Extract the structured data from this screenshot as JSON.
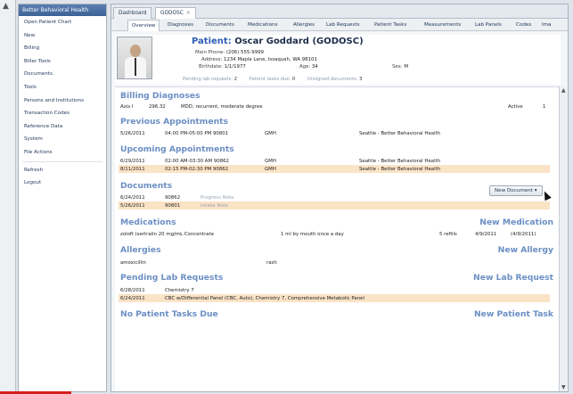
{
  "sidebar": {
    "header": "Better Behavioral Health",
    "items": [
      "Open Patient Chart",
      "New",
      "Billing",
      "Biller Tools",
      "Documents",
      "Tools",
      "Persons and Institutions",
      "Transaction Codes",
      "Reference Data",
      "System",
      "File Actions"
    ],
    "items2": [
      "Refresh",
      "Logout"
    ]
  },
  "top_tabs": [
    "Dashboard",
    "GODOSC"
  ],
  "sub_tabs": [
    "Overview",
    "Diagnoses",
    "Documents",
    "Medications",
    "Allergies",
    "Lab Requests",
    "Patient Tasks",
    "Measurements",
    "Lab Panels",
    "Codes",
    "Ima"
  ],
  "patient": {
    "label": "Patient:",
    "name": "Oscar Goddard (GODOSC)",
    "main_phone_k": "Main Phone:",
    "main_phone": "(206) 555-9999",
    "address_k": "Address:",
    "address": "1234 Maple Lane, Issaquah, WA 98101",
    "birthdate_k": "Birthdate:",
    "birthdate": "1/1/1977",
    "age_k": "Age:",
    "age": "34",
    "sex_k": "Sex:",
    "sex": "M",
    "pending_lab_k": "Pending lab requests:",
    "pending_lab": "2",
    "tasks_due_k": "Patient tasks due:",
    "tasks_due": "0",
    "unsigned_k": "Unsigned documents:",
    "unsigned": "3"
  },
  "billing": {
    "title": "Billing Diagnoses",
    "rows": [
      {
        "axis": "Axis I",
        "code": "296.32",
        "desc": "MDD, recurrent, moderate degree",
        "status": "Active",
        "n": "1"
      }
    ]
  },
  "previous": {
    "title": "Previous Appointments",
    "rows": [
      {
        "date": "5/26/2011",
        "time": "04:00 PM-05:00 PM 90801",
        "prov": "GMH",
        "loc": "Seattle - Better Behavioral Health"
      }
    ]
  },
  "upcoming": {
    "title": "Upcoming Appointments",
    "rows": [
      {
        "date": "6/29/2011",
        "time": "02:00 AM-03:30 AM 90862",
        "prov": "GMH",
        "loc": "Seattle - Better Behavioral Health"
      },
      {
        "date": "8/11/2011",
        "time": "02:15 PM-02:30 PM 90862",
        "prov": "GMH",
        "loc": "Seattle - Better Behavioral Health"
      }
    ]
  },
  "documents": {
    "title": "Documents",
    "new_button": "New Document",
    "rows": [
      {
        "date": "6/24/2011",
        "code": "90862",
        "note": "Progress Note"
      },
      {
        "date": "5/26/2011",
        "code": "90801",
        "note": "Intake Note"
      }
    ]
  },
  "medications": {
    "title": "Medications",
    "new_link": "New Medication",
    "rows": [
      {
        "drug": "zoloft (sertralin 20 mg/mL Concentrate",
        "sig": "1 ml by mouth once a day",
        "refills": "5 refills",
        "start": "4/9/2011",
        "end": "(4/9/2011)"
      }
    ]
  },
  "allergies": {
    "title": "Allergies",
    "new_link": "New Allergy",
    "rows": [
      {
        "agent": "amoxicillin",
        "reaction": "rash"
      }
    ]
  },
  "labs": {
    "title": "Pending Lab Requests",
    "new_link": "New Lab Request",
    "rows": [
      {
        "date": "6/28/2011",
        "desc": "Chemistry 7"
      },
      {
        "date": "6/24/2011",
        "desc": "CBC w/Differential Panel (CBC, Auto), Chemistry 7, Comprehensive Metabolic Panel"
      }
    ]
  },
  "tasks": {
    "title": "No Patient Tasks Due",
    "new_link": "New Patient Task"
  }
}
